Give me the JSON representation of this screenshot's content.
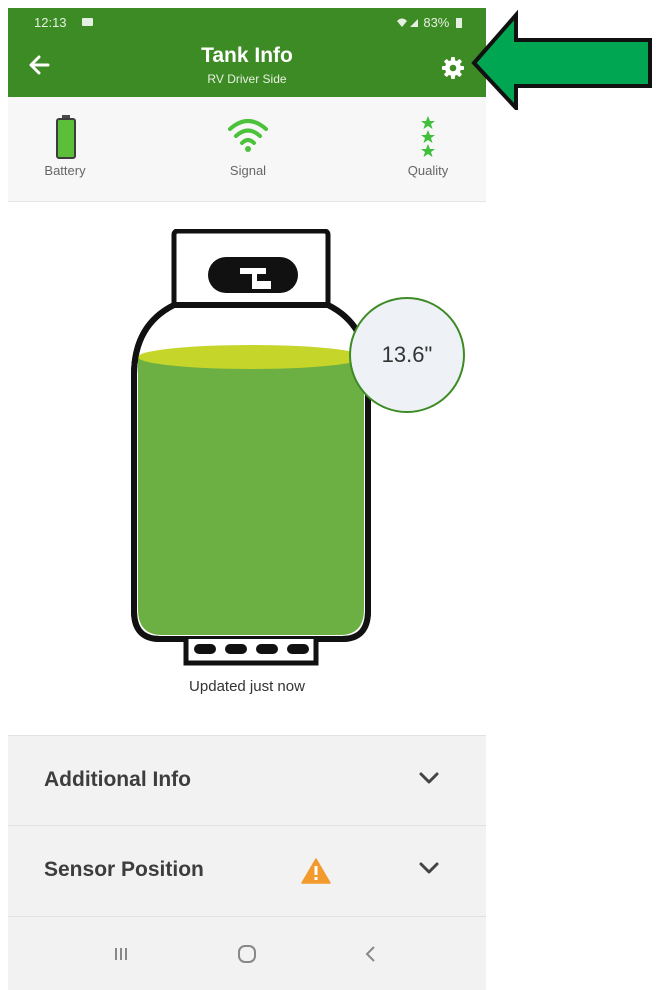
{
  "status_bar": {
    "time": "12:13",
    "battery_percent": "83%"
  },
  "header": {
    "title": "Tank Info",
    "subtitle": "RV Driver Side"
  },
  "metrics": [
    {
      "label": "Battery",
      "icon": "battery-icon"
    },
    {
      "label": "Signal",
      "icon": "wifi-signal-icon"
    },
    {
      "label": "Quality",
      "icon": "quality-stars-icon"
    }
  ],
  "tank": {
    "level": "13.6\"",
    "updated_text": "Updated just now",
    "fill_color": "#6cb043",
    "surface_color": "#c5d52a"
  },
  "accordions": [
    {
      "label": "Additional Info"
    },
    {
      "label": "Sensor Position"
    }
  ],
  "colors": {
    "brand_green": "#3d8b24",
    "warning_orange": "#f39a2d",
    "annotation_arrow": "#00a651"
  }
}
